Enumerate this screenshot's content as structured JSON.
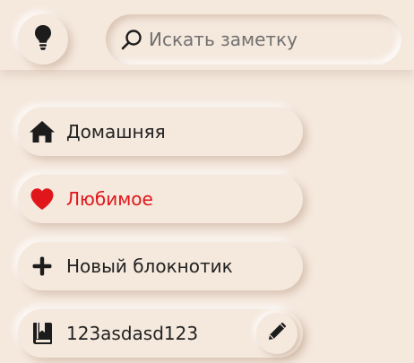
{
  "search": {
    "placeholder": "Искать заметку",
    "value": ""
  },
  "icons": {
    "idea_button": "lightbulb-icon",
    "search": "search-icon",
    "home": "home-icon",
    "favorites": "heart-icon",
    "new_notebook": "plus-icon",
    "notebook": "notebook-icon",
    "edit": "pencil-icon"
  },
  "nav": {
    "home_label": "Домашняя",
    "favorites_label": "Любимое",
    "new_notebook_label": "Новый блокнотик"
  },
  "notebooks": [
    {
      "name": "123asdasd123"
    }
  ],
  "colors": {
    "background": "#f5e8dd",
    "text": "#222222",
    "favorites_accent": "#e0161b",
    "placeholder": "#707070"
  }
}
